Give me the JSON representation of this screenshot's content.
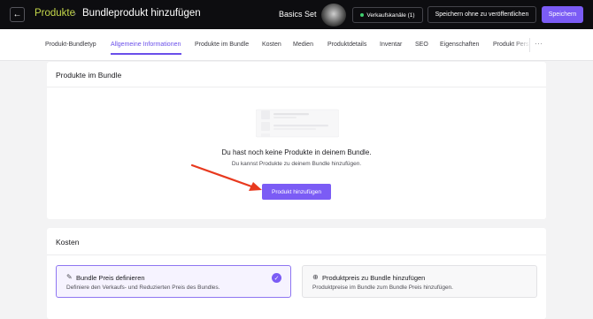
{
  "topbar": {
    "back_icon": "arrow-left-icon",
    "breadcrumb_root": "Produkte",
    "breadcrumb_separator": "›",
    "breadcrumb_current": "Bundleprodukt hinzufügen",
    "product_name": "Basics Set",
    "channels_button": "Verkaufskanäle (1)",
    "save_unpublished_button": "Speichern ohne zu veröffentlichen",
    "save_button": "Speichern"
  },
  "tabs": [
    {
      "label": "Produkt-Bundletyp"
    },
    {
      "label": "Allgemeine Informationen",
      "active": true
    },
    {
      "label": "Produkte im Bundle"
    },
    {
      "label": "Kosten"
    },
    {
      "label": "Medien"
    },
    {
      "label": "Produktdetails"
    },
    {
      "label": "Inventar"
    },
    {
      "label": "SEO"
    },
    {
      "label": "Eigenschaften"
    },
    {
      "label": "Produkt Pers"
    }
  ],
  "tabs_more": "···",
  "bundle_card": {
    "title": "Produkte im Bundle",
    "empty_heading": "Du hast noch keine Produkte in deinem Bundle.",
    "empty_subtext": "Du kannst Produkte zu deinem Bundle hinzufügen.",
    "add_button": "Produkt hinzufügen"
  },
  "costs_card": {
    "title": "Kosten",
    "options": [
      {
        "icon": "pencil-icon",
        "title": "Bundle Preis definieren",
        "description": "Definiere den Verkaufs- und Reduzierten Preis des Bundles.",
        "selected": true
      },
      {
        "icon": "plus-circle-icon",
        "title": "Produktpreis zu Bundle hinzufügen",
        "description": "Produktpreise im Bundle zum Bundle Preis hinzufügen.",
        "selected": false
      }
    ]
  },
  "colors": {
    "accent": "#7b5cf5",
    "topbar_bg": "#0d0d10",
    "breadcrumb_root": "#c5d84a",
    "status_dot": "#3ecf6e",
    "annotation_arrow": "#e8391e"
  }
}
